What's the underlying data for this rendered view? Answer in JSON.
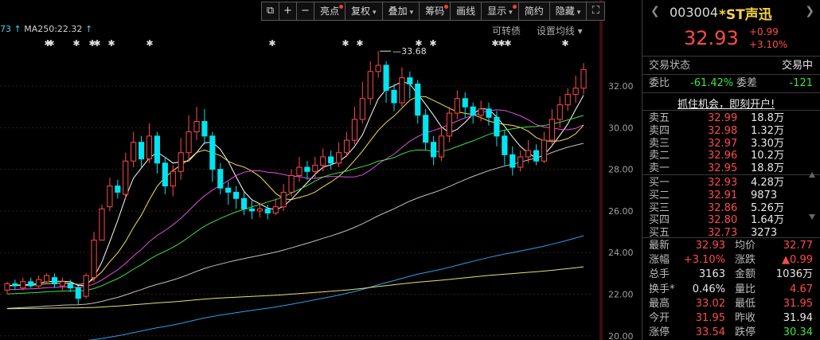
{
  "toolbar": {
    "items": [
      {
        "label": "⧉",
        "icon": "copy-icon"
      },
      {
        "label": "+",
        "icon": "plus-icon"
      },
      {
        "label": "−",
        "icon": "minus-icon"
      },
      {
        "label": "亮点",
        "dot": true
      },
      {
        "label": "复权",
        "dropdown": true
      },
      {
        "label": "叠加",
        "dropdown": true
      },
      {
        "label": "筹码",
        "dot": true
      },
      {
        "label": "画线"
      },
      {
        "label": "显示",
        "dropdown": true,
        "dot": true
      },
      {
        "label": "简约"
      },
      {
        "label": "隐藏",
        "dropdown": true
      },
      {
        "label": "⛶",
        "icon": "fullscreen-icon"
      }
    ]
  },
  "ma_label": {
    "left_value": "73",
    "ma250": "MA250:22.32",
    "arrow": "↑"
  },
  "chart_links": [
    "可转债",
    "设置均线 ▾"
  ],
  "chart_data": {
    "type": "candlestick",
    "ylim": [
      19.8,
      34.3
    ],
    "yticks": [
      "20.00",
      "22.00",
      "24.00",
      "26.00",
      "28.00",
      "30.00",
      "32.00"
    ],
    "high_marker": "33.68",
    "colors": {
      "up": "#ff4a4a",
      "down": "#00e5f0",
      "ma5": "#ffffff",
      "ma10": "#f5e050",
      "ma20": "#e050e0",
      "ma30": "#40e040",
      "ma60": "#c0c0c0",
      "ma120": "#2aa0e8",
      "ma250": "#e8e070"
    },
    "candles": [
      [
        22.2,
        22.5,
        22.6,
        22.0
      ],
      [
        22.5,
        22.4,
        22.7,
        22.2
      ],
      [
        22.3,
        22.6,
        22.8,
        22.2
      ],
      [
        22.6,
        22.4,
        22.8,
        22.3
      ],
      [
        22.4,
        22.7,
        22.9,
        22.3
      ],
      [
        22.6,
        22.9,
        23.0,
        22.5
      ],
      [
        22.8,
        22.5,
        23.0,
        22.3
      ],
      [
        22.4,
        22.6,
        22.8,
        22.2
      ],
      [
        22.5,
        22.3,
        22.7,
        22.1
      ],
      [
        22.3,
        21.8,
        22.4,
        21.5
      ],
      [
        21.9,
        22.9,
        23.0,
        21.8
      ],
      [
        22.8,
        24.6,
        25.0,
        22.6
      ],
      [
        24.6,
        26.1,
        26.3,
        24.6
      ],
      [
        26.2,
        27.2,
        27.6,
        26.0
      ],
      [
        27.2,
        26.9,
        27.5,
        26.6
      ],
      [
        26.8,
        28.4,
        28.8,
        26.6
      ],
      [
        28.4,
        29.3,
        29.8,
        28.1
      ],
      [
        29.3,
        28.5,
        29.6,
        28.1
      ],
      [
        28.5,
        29.6,
        30.2,
        28.3
      ],
      [
        29.6,
        28.3,
        29.8,
        27.8
      ],
      [
        28.3,
        27.2,
        28.6,
        26.8
      ],
      [
        27.2,
        27.9,
        28.2,
        26.7
      ],
      [
        27.9,
        28.8,
        29.5,
        27.5
      ],
      [
        28.8,
        29.8,
        30.6,
        28.4
      ],
      [
        29.8,
        30.3,
        31.0,
        29.4
      ],
      [
        30.3,
        29.6,
        30.9,
        29.2
      ],
      [
        29.6,
        28.0,
        29.8,
        27.4
      ],
      [
        28.0,
        27.1,
        28.3,
        26.8
      ],
      [
        27.1,
        26.9,
        27.4,
        26.3
      ],
      [
        26.9,
        26.6,
        27.2,
        26.1
      ],
      [
        26.6,
        26.1,
        26.9,
        25.8
      ],
      [
        26.1,
        26.0,
        26.5,
        25.6
      ],
      [
        26.0,
        26.1,
        26.4,
        25.7
      ],
      [
        26.1,
        25.9,
        26.3,
        25.6
      ],
      [
        25.9,
        26.2,
        26.6,
        25.8
      ],
      [
        26.2,
        26.9,
        27.3,
        26.0
      ],
      [
        26.9,
        27.7,
        28.0,
        26.7
      ],
      [
        27.7,
        28.1,
        28.6,
        27.4
      ],
      [
        28.1,
        27.9,
        28.4,
        27.5
      ],
      [
        27.9,
        28.2,
        28.6,
        27.6
      ],
      [
        28.2,
        28.6,
        29.0,
        27.9
      ],
      [
        28.6,
        28.3,
        28.9,
        28.0
      ],
      [
        28.3,
        28.8,
        29.3,
        28.1
      ],
      [
        28.8,
        29.4,
        29.8,
        28.6
      ],
      [
        29.4,
        30.4,
        31.0,
        29.2
      ],
      [
        30.4,
        31.4,
        32.2,
        30.2
      ],
      [
        31.4,
        32.7,
        33.2,
        31.1
      ],
      [
        32.7,
        33.0,
        33.68,
        32.4
      ],
      [
        33.0,
        31.8,
        33.2,
        31.2
      ],
      [
        31.8,
        31.2,
        32.1,
        30.8
      ],
      [
        31.2,
        32.4,
        32.9,
        31.0
      ],
      [
        32.4,
        32.1,
        32.7,
        31.4
      ],
      [
        32.1,
        30.6,
        32.3,
        30.2
      ],
      [
        30.6,
        29.3,
        30.9,
        28.9
      ],
      [
        29.3,
        28.6,
        29.6,
        28.2
      ],
      [
        28.6,
        29.6,
        30.0,
        28.4
      ],
      [
        29.6,
        30.7,
        31.0,
        29.3
      ],
      [
        30.7,
        31.4,
        31.8,
        30.4
      ],
      [
        31.4,
        31.0,
        31.7,
        30.5
      ],
      [
        31.0,
        30.6,
        31.2,
        30.2
      ],
      [
        30.6,
        30.9,
        31.3,
        30.3
      ],
      [
        30.9,
        30.5,
        31.2,
        30.1
      ],
      [
        30.5,
        29.6,
        30.8,
        29.1
      ],
      [
        29.6,
        28.7,
        29.9,
        28.2
      ],
      [
        28.7,
        28.1,
        29.1,
        27.7
      ],
      [
        28.1,
        28.6,
        28.9,
        27.9
      ],
      [
        28.6,
        28.9,
        29.4,
        28.3
      ],
      [
        28.9,
        28.4,
        29.2,
        28.2
      ],
      [
        28.4,
        29.4,
        29.8,
        28.3
      ],
      [
        29.4,
        30.4,
        30.9,
        29.2
      ],
      [
        30.4,
        31.1,
        31.5,
        30.0
      ],
      [
        31.1,
        31.6,
        31.9,
        30.8
      ],
      [
        31.6,
        31.9,
        32.5,
        31.2
      ],
      [
        31.9,
        32.8,
        33.1,
        31.6
      ]
    ]
  },
  "panel": {
    "code": "003004",
    "name": "*ST声迅",
    "price": "32.93",
    "change": "+0.99",
    "change_pct": "+3.10%",
    "status_label": "交易状态",
    "status_value": "交易中",
    "weibi_label": "委比",
    "weibi_value": "-61.42%",
    "weicha_label": "委差",
    "weicha_value": "-121",
    "promo": "抓住机会，即刻开户!",
    "sells": [
      {
        "label": "卖五",
        "price": "32.99",
        "vol": "18.8万"
      },
      {
        "label": "卖四",
        "price": "32.98",
        "vol": "1.32万"
      },
      {
        "label": "卖三",
        "price": "32.97",
        "vol": "3.30万"
      },
      {
        "label": "卖二",
        "price": "32.96",
        "vol": "10.2万"
      },
      {
        "label": "卖一",
        "price": "32.95",
        "vol": "18.8万"
      }
    ],
    "buys": [
      {
        "label": "买一",
        "price": "32.93",
        "vol": "4.28万"
      },
      {
        "label": "买二",
        "price": "32.91",
        "vol": "9873"
      },
      {
        "label": "买三",
        "price": "32.86",
        "vol": "5.26万"
      },
      {
        "label": "买四",
        "price": "32.80",
        "vol": "1.64万"
      },
      {
        "label": "买五",
        "price": "32.73",
        "vol": "3273"
      }
    ],
    "stats": [
      {
        "l1": "最新",
        "v1": "32.93",
        "c1": "red",
        "l2": "均价",
        "v2": "32.77",
        "c2": "red"
      },
      {
        "l1": "涨幅",
        "v1": "+3.10%",
        "c1": "red",
        "l2": "涨跌",
        "v2": "▲0.99",
        "c2": "red"
      },
      {
        "l1": "总手",
        "v1": "3163",
        "c1": "white",
        "l2": "金额",
        "v2": "1036万",
        "c2": "white"
      },
      {
        "l1": "换手*",
        "v1": "0.46%",
        "c1": "white",
        "l2": "量比",
        "v2": "4.67",
        "c2": "red"
      },
      {
        "l1": "最高",
        "v1": "33.02",
        "c1": "red",
        "l2": "最低",
        "v2": "31.95",
        "c2": "red"
      },
      {
        "l1": "今开",
        "v1": "31.95",
        "c1": "red",
        "l2": "昨收",
        "v2": "31.94",
        "c2": "white"
      },
      {
        "l1": "涨停",
        "v1": "33.54",
        "c1": "red",
        "l2": "跌停",
        "v2": "30.34",
        "c2": "green"
      }
    ]
  }
}
